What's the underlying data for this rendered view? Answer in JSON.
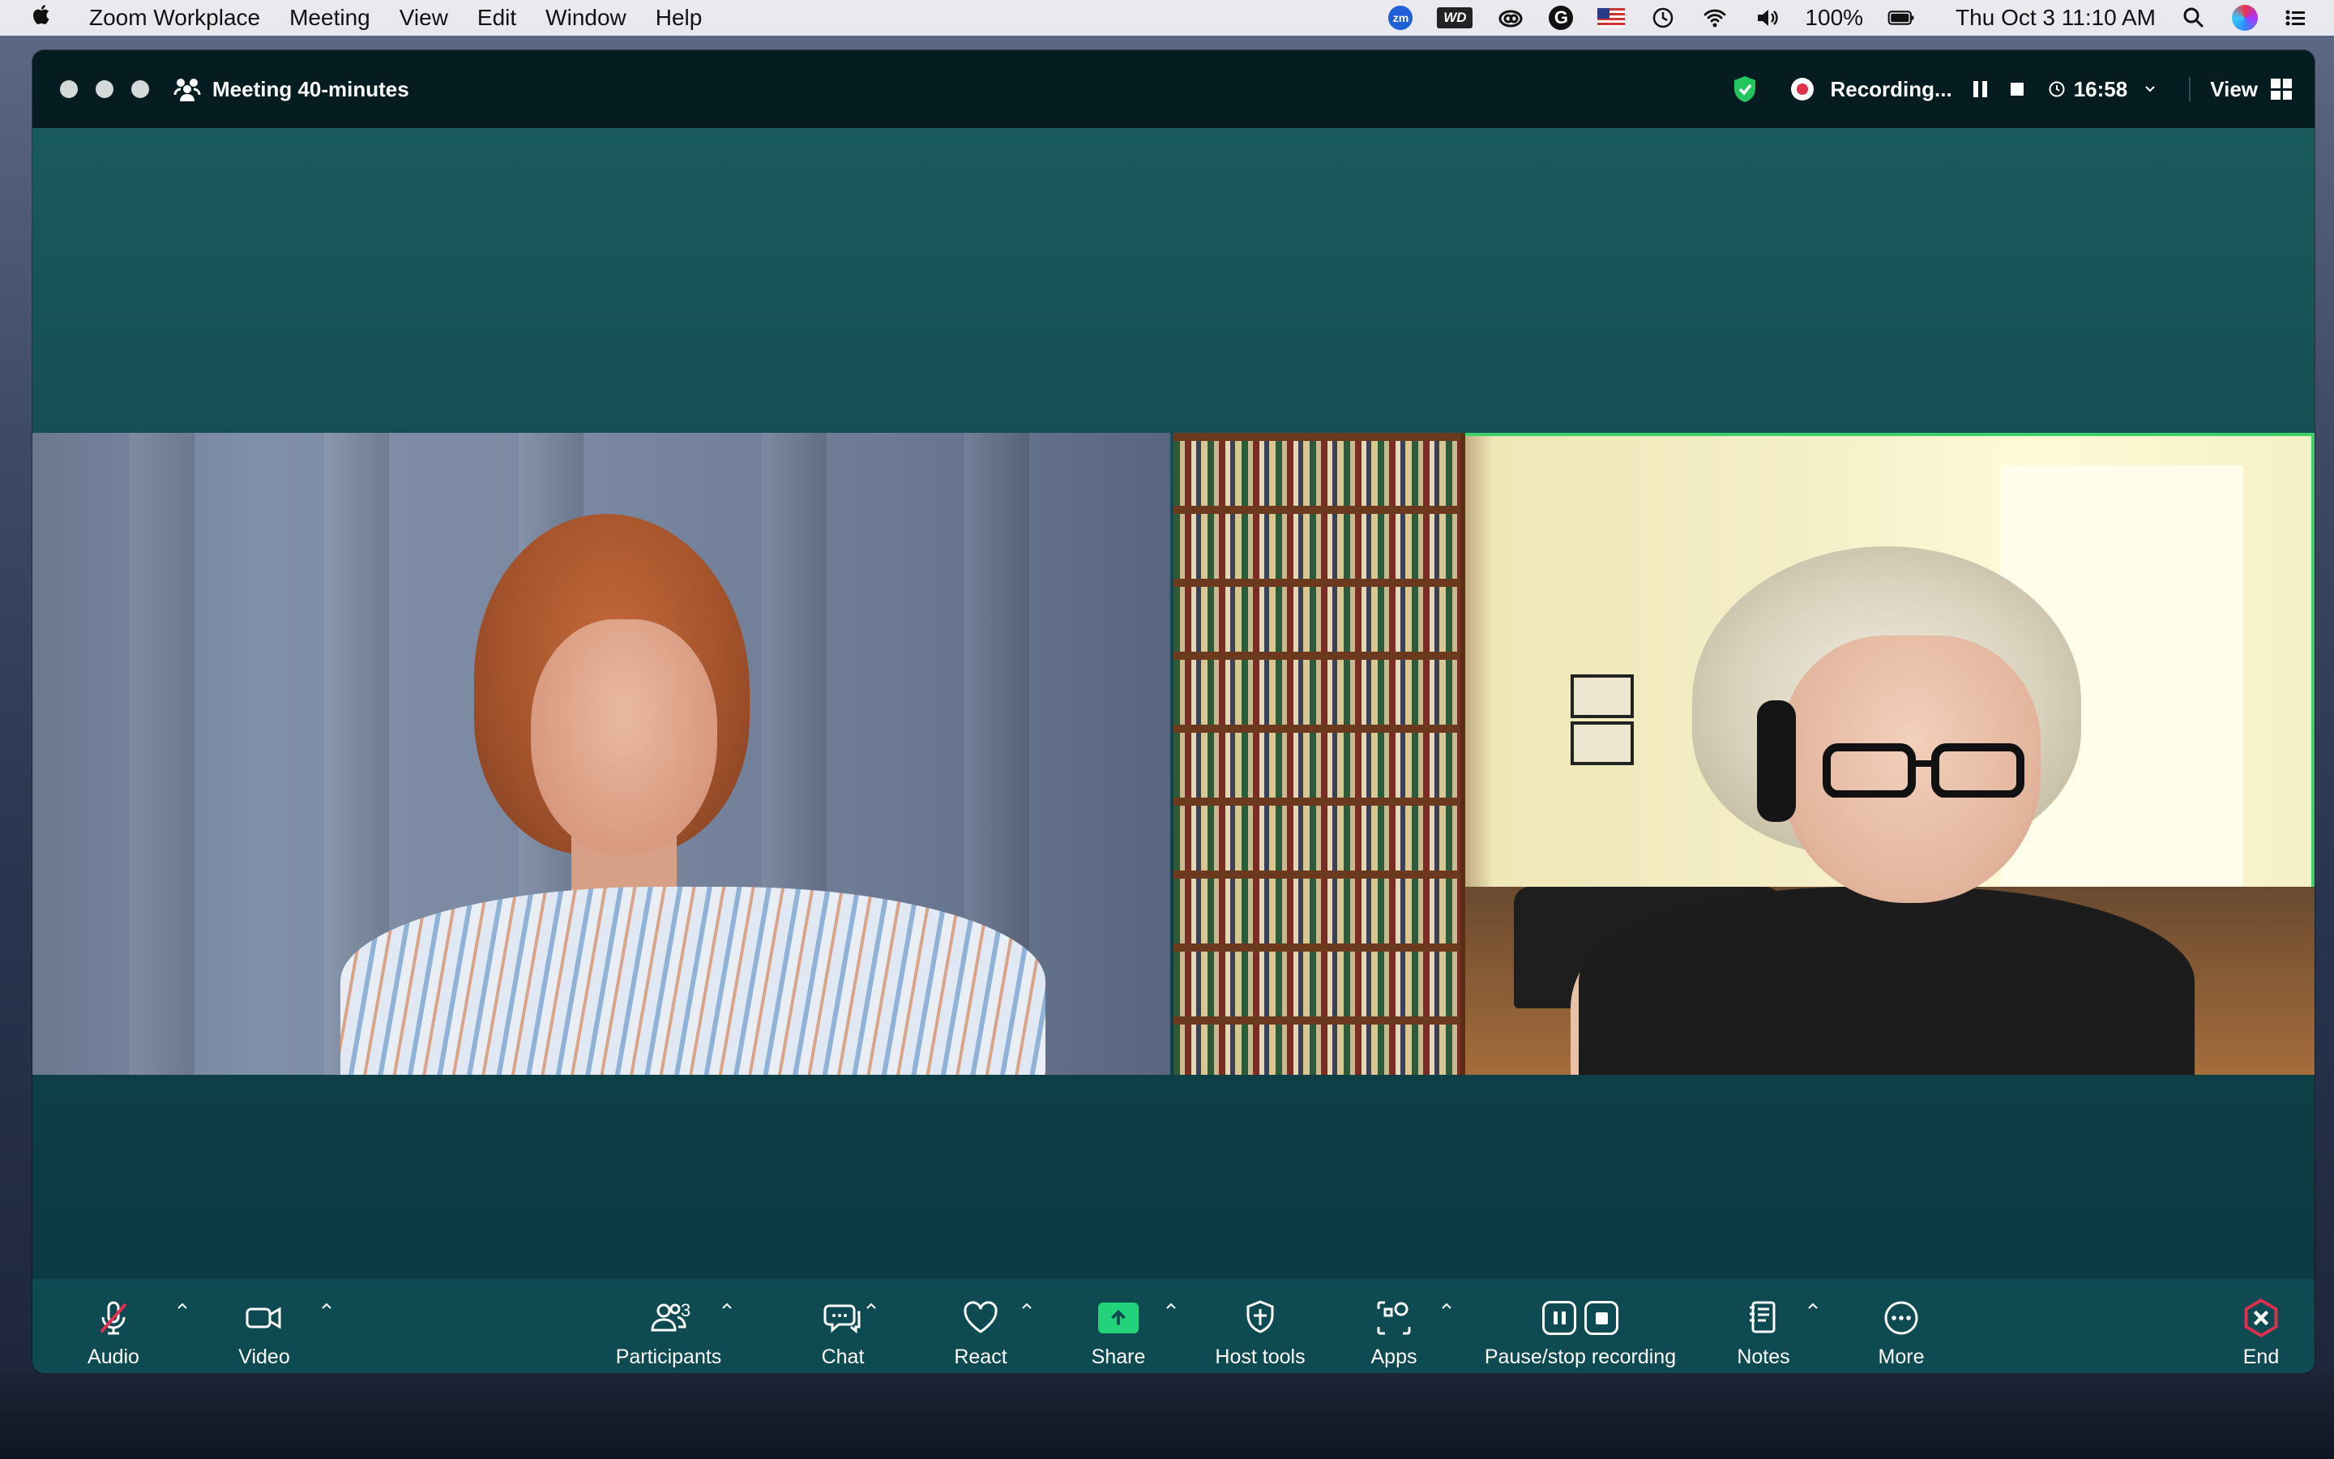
{
  "menubar": {
    "app_name": "Zoom Workplace",
    "menus": [
      "Meeting",
      "View",
      "Edit",
      "Window",
      "Help"
    ],
    "status": {
      "zoom_badge": "zm",
      "wd_badge": "WD",
      "grammarly_badge": "G",
      "battery_percent": "100%",
      "datetime": "Thu Oct 3  11:10 AM"
    }
  },
  "meeting": {
    "title": "Meeting  40-minutes",
    "recording_label": "Recording...",
    "timer": "16:58",
    "view_label": "View",
    "active_speaker_border_color": "#3fcf6a"
  },
  "toolbar": {
    "audio_label": "Audio",
    "video_label": "Video",
    "participants_label": "Participants",
    "participants_count": "3",
    "chat_label": "Chat",
    "react_label": "React",
    "share_label": "Share",
    "host_tools_label": "Host tools",
    "apps_label": "Apps",
    "pause_stop_label": "Pause/stop recording",
    "notes_label": "Notes",
    "more_label": "More",
    "end_label": "End",
    "share_color": "#22d37a",
    "end_color": "#e0304e"
  }
}
